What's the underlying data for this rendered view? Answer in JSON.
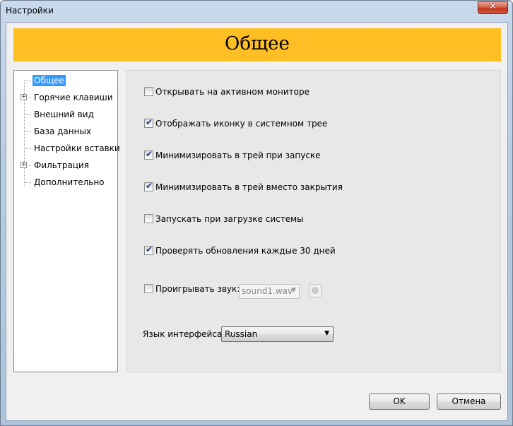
{
  "window": {
    "title": "Настройки",
    "close_symbol": "✕"
  },
  "header": {
    "title": "Общее"
  },
  "tree": {
    "items": [
      {
        "label": "Общее",
        "selected": true,
        "expandable": false
      },
      {
        "label": "Горячие клавиши",
        "selected": false,
        "expandable": true
      },
      {
        "label": "Внешний вид",
        "selected": false,
        "expandable": false
      },
      {
        "label": "База данных",
        "selected": false,
        "expandable": false
      },
      {
        "label": "Настройки вставки",
        "selected": false,
        "expandable": false
      },
      {
        "label": "Фильтрация",
        "selected": false,
        "expandable": true
      },
      {
        "label": "Дополнительно",
        "selected": false,
        "expandable": false
      }
    ],
    "expander_symbol": "+"
  },
  "options": [
    {
      "label": "Открывать на активном мониторе",
      "checked": false
    },
    {
      "label": "Отображать иконку в системном трее",
      "checked": true
    },
    {
      "label": "Минимизировать в трей при запуске",
      "checked": true
    },
    {
      "label": "Минимизировать в трей вместо закрытия",
      "checked": true
    },
    {
      "label": "Запускать при загрузке системы",
      "checked": false
    },
    {
      "label": "Проверять обновления каждые 30 дней",
      "checked": true
    },
    {
      "label": "Проигрывать звук:",
      "checked": false
    }
  ],
  "sound": {
    "selected": "sound1.wav",
    "enabled": false,
    "play_icon": "play-icon"
  },
  "language": {
    "label": "Язык интерфейса",
    "selected": "Russian"
  },
  "buttons": {
    "ok": "OK",
    "cancel": "Отмена"
  },
  "colors": {
    "header_band": "#fdbf23",
    "selection": "#3399ff"
  }
}
